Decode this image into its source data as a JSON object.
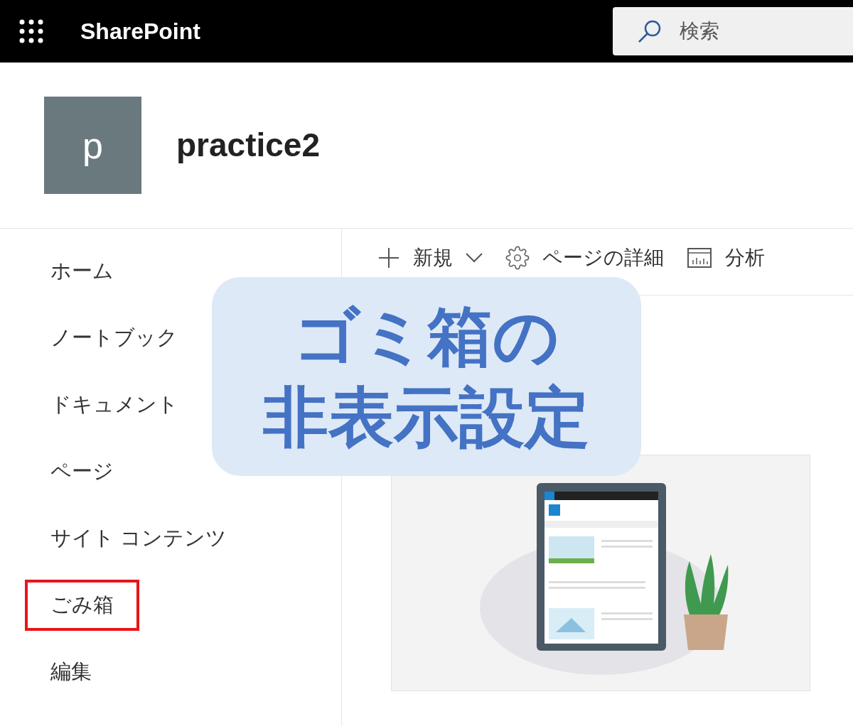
{
  "top_bar": {
    "app_name": "SharePoint",
    "search": {
      "placeholder": "検索"
    }
  },
  "site": {
    "logo_letter": "p",
    "title": "practice2"
  },
  "nav": {
    "items": [
      {
        "label": "ホーム",
        "highlighted": false
      },
      {
        "label": "ノートブック",
        "highlighted": false
      },
      {
        "label": "ドキュメント",
        "highlighted": false
      },
      {
        "label": "ページ",
        "highlighted": false
      },
      {
        "label": "サイト コンテンツ",
        "highlighted": false
      },
      {
        "label": "ごみ箱",
        "highlighted": true
      },
      {
        "label": "編集",
        "highlighted": false
      }
    ]
  },
  "command_bar": [
    {
      "kind": "new",
      "label": "新規"
    },
    {
      "kind": "details",
      "label": "ページの詳細"
    },
    {
      "kind": "analytics",
      "label": "分析"
    }
  ],
  "overlay_title": {
    "lines": [
      "ゴミ箱の",
      "非表示設定"
    ]
  }
}
